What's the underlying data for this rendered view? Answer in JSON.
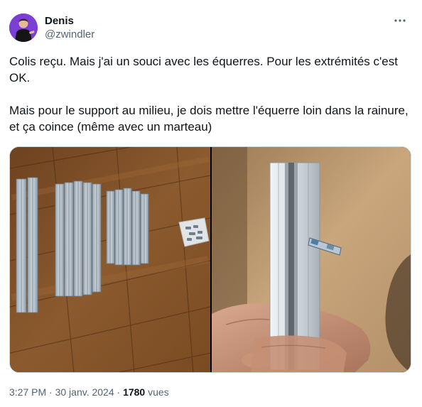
{
  "author": {
    "display_name": "Denis",
    "handle": "@zwindler",
    "avatar_icon": "user-avatar"
  },
  "menu": {
    "more_icon": "more-horizontal-icon"
  },
  "tweet": {
    "paragraph_1": "Colis reçu. Mais j'ai un souci avec les équerres. Pour les extrémités c'est OK.",
    "paragraph_2": "Mais pour le support au milieu, je dois mettre l'équerre loin dans la rainure, et ça coince (même avec un marteau)"
  },
  "media": {
    "images": [
      {
        "subject": "aluminium-profiles-on-wood-floor"
      },
      {
        "subject": "profile-with-bracket-in-hand"
      }
    ]
  },
  "meta": {
    "time": "3:27 PM",
    "separator": "·",
    "date": "30 janv. 2024",
    "views_count": "1780",
    "views_label": "vues"
  },
  "colors": {
    "text_primary": "#0f1419",
    "text_secondary": "#536471",
    "border": "#cfd9de",
    "avatar_bg": "#7b3fd6"
  }
}
